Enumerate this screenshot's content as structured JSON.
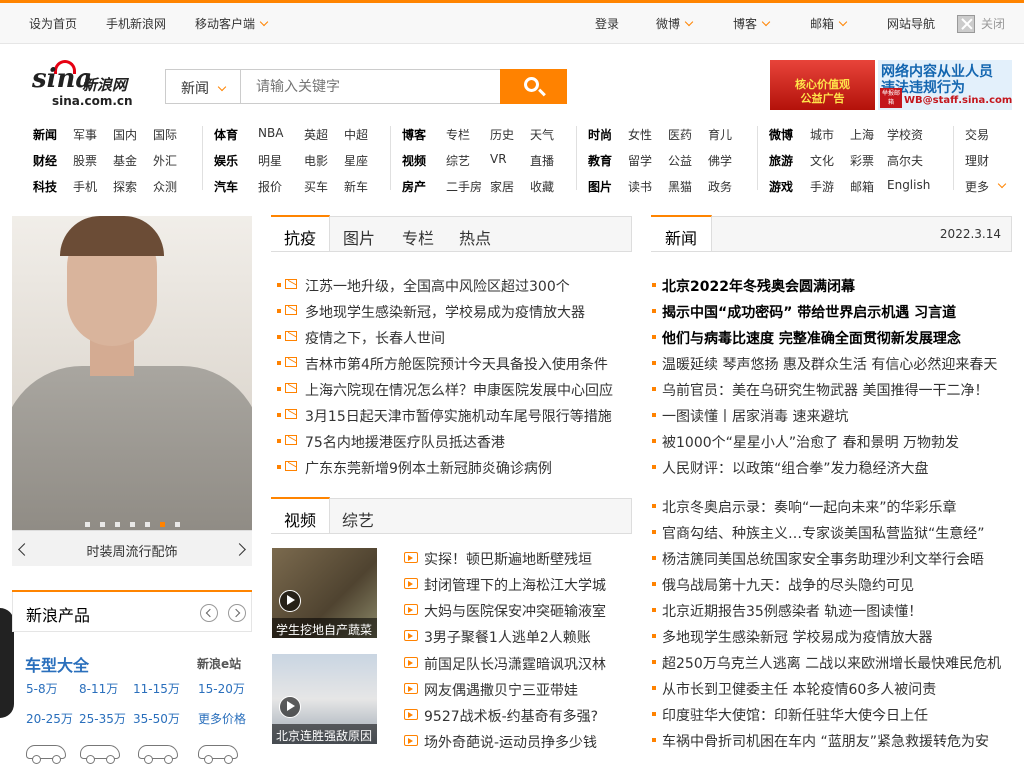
{
  "topbar": {
    "home": "设为首页",
    "mobile_sina": "手机新浪网",
    "mobile_client": "移动客户端",
    "login": "登录",
    "weibo": "微博",
    "blog": "博客",
    "mail": "邮箱",
    "site_nav": "网站导航",
    "close": "关闭"
  },
  "logo": {
    "word": "sina",
    "cn": "新浪网",
    "domain": "sina.com.cn"
  },
  "search": {
    "category": "新闻",
    "placeholder": "请输入关键字"
  },
  "ad": {
    "left_line1": "核心价值观",
    "left_line2": "公益广告",
    "right_line1": "网络内容从业人员",
    "right_line2": "违法违规行为",
    "badge": "举报邮箱",
    "email": "WB@staff.sina.com"
  },
  "nav": [
    {
      "rows": [
        [
          "新闻",
          "军事",
          "国内",
          "国际"
        ],
        [
          "财经",
          "股票",
          "基金",
          "外汇"
        ],
        [
          "科技",
          "手机",
          "探索",
          "众测"
        ]
      ]
    },
    {
      "rows": [
        [
          "体育",
          "NBA",
          "英超",
          "中超"
        ],
        [
          "娱乐",
          "明星",
          "电影",
          "星座"
        ],
        [
          "汽车",
          "报价",
          "买车",
          "新车"
        ]
      ]
    },
    {
      "rows": [
        [
          "博客",
          "专栏",
          "历史",
          "天气"
        ],
        [
          "视频",
          "综艺",
          "VR",
          "直播"
        ],
        [
          "房产",
          "二手房",
          "家居",
          "收藏"
        ]
      ]
    },
    {
      "rows": [
        [
          "时尚",
          "女性",
          "医药",
          "育儿"
        ],
        [
          "教育",
          "留学",
          "公益",
          "佛学"
        ],
        [
          "图片",
          "读书",
          "黑猫",
          "政务"
        ]
      ]
    },
    {
      "rows": [
        [
          "微博",
          "城市",
          "上海",
          "学校资"
        ],
        [
          "旅游",
          "文化",
          "彩票",
          "高尔夫"
        ],
        [
          "游戏",
          "手游",
          "邮箱",
          "English"
        ]
      ]
    },
    {
      "rows": [
        [
          "交易"
        ],
        [
          "理财"
        ],
        [
          "更多"
        ]
      ]
    }
  ],
  "hero": {
    "caption": "时装周流行配饰"
  },
  "products": {
    "title": "新浪产品",
    "car_title": "车型大全",
    "ezhan": "新浪e站",
    "prices": [
      "5-8万",
      "8-11万",
      "11-15万",
      "15-20万",
      "20-25万",
      "25-35万",
      "35-50万",
      "更多价格"
    ]
  },
  "mid_tabs1": [
    "抗疫",
    "图片",
    "专栏",
    "热点"
  ],
  "mid_news1": [
    "江苏一地升级，全国高中风险区超过300个",
    "多地现学生感染新冠，学校易成为疫情放大器",
    "疫情之下，长春人世间",
    "吉林市第4所方舱医院预计今天具备投入使用条件",
    "上海六院现在情况怎么样？申康医院发展中心回应",
    "3月15日起天津市暂停实施机动车尾号限行等措施",
    "75名内地援港医疗队员抵达香港",
    "广东东莞新增9例本土新冠肺炎确诊病例"
  ],
  "mid_tabs2": [
    "视频",
    "综艺"
  ],
  "video_thumbs": [
    "学生挖地自产蔬菜",
    "北京连胜强敌原因"
  ],
  "mid_news2": [
    "实探！顿巴斯遍地断壁残垣",
    "封闭管理下的上海松江大学城",
    "大妈与医院保安冲突砸输液室",
    "3男子聚餐1人逃单2人赖账",
    "前国足队长冯潇霆暗讽巩汉林",
    "网友偶遇撒贝宁三亚带娃",
    "9527战术板-约基奇有多强?",
    "场外奇葩说-运动员挣多少钱"
  ],
  "right": {
    "tab": "新闻",
    "date": "2022.3.14",
    "bold_news": [
      "北京2022年冬残奥会圆满闭幕",
      "揭示中国“成功密码” 带给世界启示机遇 习言道",
      "他们与病毒比速度 完整准确全面贯彻新发展理念"
    ],
    "news": [
      "温暖延续 琴声悠扬 惠及群众生活 有信心必然迎来春天",
      "乌前官员：美在乌研究生物武器 美国推得一干二净！",
      "一图读懂丨居家消毒 速来避坑",
      "被1000个“星星小人”治愈了 春和景明 万物勃发",
      "人民财评：以政策“组合拳”发力稳经济大盘"
    ],
    "news2": [
      "北京冬奥启示录：奏响“一起向未来”的华彩乐章",
      "官商勾结、种族主义…专家谈美国私营监狱“生意经”",
      "杨洁篪同美国总统国家安全事务助理沙利文举行会晤",
      "俄乌战局第十九天：战争的尽头隐约可见",
      "北京近期报告35例感染者 轨迹一图读懂！",
      "多地现学生感染新冠 学校易成为疫情放大器",
      "超250万乌克兰人逃离 二战以来欧洲增长最快难民危机",
      "从市长到卫健委主任 本轮疫情60多人被问责",
      "印度驻华大使馆：印新任驻华大使今日上任",
      "车祸中骨折司机困在车内 “蓝朋友”紧急救援转危为安"
    ]
  }
}
